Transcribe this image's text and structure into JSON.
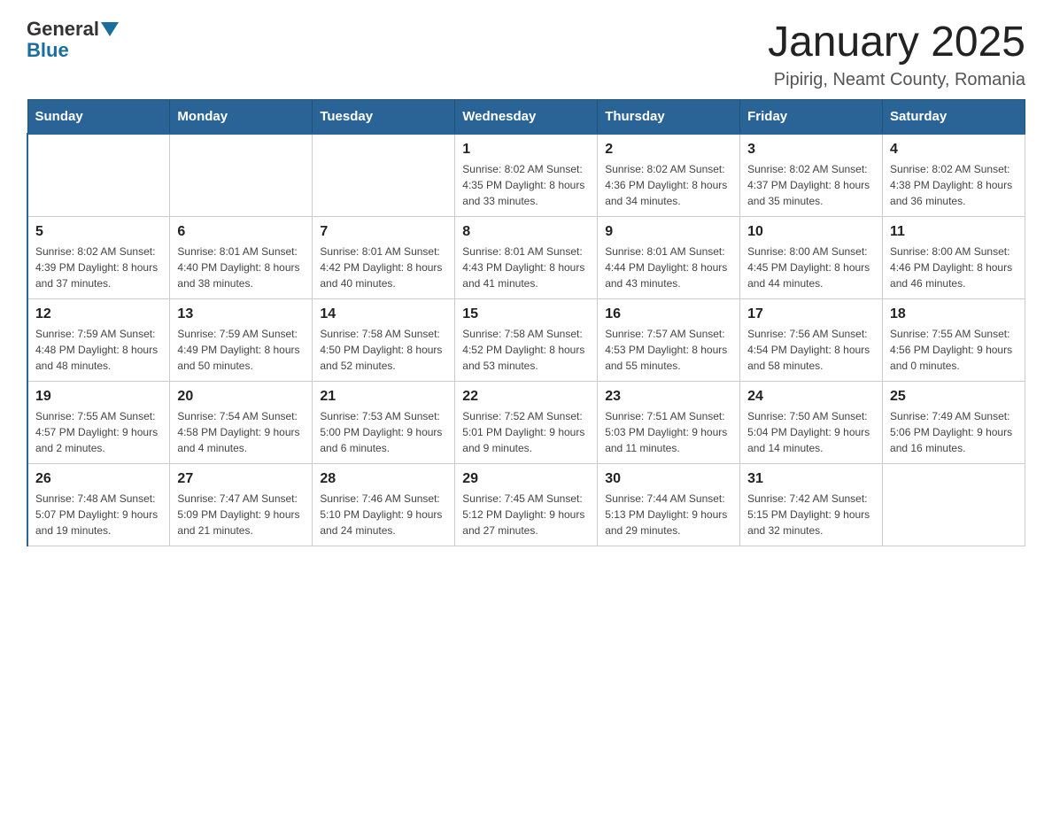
{
  "header": {
    "logo_general": "General",
    "logo_blue": "Blue",
    "month_title": "January 2025",
    "location": "Pipirig, Neamt County, Romania"
  },
  "days_of_week": [
    "Sunday",
    "Monday",
    "Tuesday",
    "Wednesday",
    "Thursday",
    "Friday",
    "Saturday"
  ],
  "weeks": [
    [
      {
        "day": "",
        "info": ""
      },
      {
        "day": "",
        "info": ""
      },
      {
        "day": "",
        "info": ""
      },
      {
        "day": "1",
        "info": "Sunrise: 8:02 AM\nSunset: 4:35 PM\nDaylight: 8 hours\nand 33 minutes."
      },
      {
        "day": "2",
        "info": "Sunrise: 8:02 AM\nSunset: 4:36 PM\nDaylight: 8 hours\nand 34 minutes."
      },
      {
        "day": "3",
        "info": "Sunrise: 8:02 AM\nSunset: 4:37 PM\nDaylight: 8 hours\nand 35 minutes."
      },
      {
        "day": "4",
        "info": "Sunrise: 8:02 AM\nSunset: 4:38 PM\nDaylight: 8 hours\nand 36 minutes."
      }
    ],
    [
      {
        "day": "5",
        "info": "Sunrise: 8:02 AM\nSunset: 4:39 PM\nDaylight: 8 hours\nand 37 minutes."
      },
      {
        "day": "6",
        "info": "Sunrise: 8:01 AM\nSunset: 4:40 PM\nDaylight: 8 hours\nand 38 minutes."
      },
      {
        "day": "7",
        "info": "Sunrise: 8:01 AM\nSunset: 4:42 PM\nDaylight: 8 hours\nand 40 minutes."
      },
      {
        "day": "8",
        "info": "Sunrise: 8:01 AM\nSunset: 4:43 PM\nDaylight: 8 hours\nand 41 minutes."
      },
      {
        "day": "9",
        "info": "Sunrise: 8:01 AM\nSunset: 4:44 PM\nDaylight: 8 hours\nand 43 minutes."
      },
      {
        "day": "10",
        "info": "Sunrise: 8:00 AM\nSunset: 4:45 PM\nDaylight: 8 hours\nand 44 minutes."
      },
      {
        "day": "11",
        "info": "Sunrise: 8:00 AM\nSunset: 4:46 PM\nDaylight: 8 hours\nand 46 minutes."
      }
    ],
    [
      {
        "day": "12",
        "info": "Sunrise: 7:59 AM\nSunset: 4:48 PM\nDaylight: 8 hours\nand 48 minutes."
      },
      {
        "day": "13",
        "info": "Sunrise: 7:59 AM\nSunset: 4:49 PM\nDaylight: 8 hours\nand 50 minutes."
      },
      {
        "day": "14",
        "info": "Sunrise: 7:58 AM\nSunset: 4:50 PM\nDaylight: 8 hours\nand 52 minutes."
      },
      {
        "day": "15",
        "info": "Sunrise: 7:58 AM\nSunset: 4:52 PM\nDaylight: 8 hours\nand 53 minutes."
      },
      {
        "day": "16",
        "info": "Sunrise: 7:57 AM\nSunset: 4:53 PM\nDaylight: 8 hours\nand 55 minutes."
      },
      {
        "day": "17",
        "info": "Sunrise: 7:56 AM\nSunset: 4:54 PM\nDaylight: 8 hours\nand 58 minutes."
      },
      {
        "day": "18",
        "info": "Sunrise: 7:55 AM\nSunset: 4:56 PM\nDaylight: 9 hours\nand 0 minutes."
      }
    ],
    [
      {
        "day": "19",
        "info": "Sunrise: 7:55 AM\nSunset: 4:57 PM\nDaylight: 9 hours\nand 2 minutes."
      },
      {
        "day": "20",
        "info": "Sunrise: 7:54 AM\nSunset: 4:58 PM\nDaylight: 9 hours\nand 4 minutes."
      },
      {
        "day": "21",
        "info": "Sunrise: 7:53 AM\nSunset: 5:00 PM\nDaylight: 9 hours\nand 6 minutes."
      },
      {
        "day": "22",
        "info": "Sunrise: 7:52 AM\nSunset: 5:01 PM\nDaylight: 9 hours\nand 9 minutes."
      },
      {
        "day": "23",
        "info": "Sunrise: 7:51 AM\nSunset: 5:03 PM\nDaylight: 9 hours\nand 11 minutes."
      },
      {
        "day": "24",
        "info": "Sunrise: 7:50 AM\nSunset: 5:04 PM\nDaylight: 9 hours\nand 14 minutes."
      },
      {
        "day": "25",
        "info": "Sunrise: 7:49 AM\nSunset: 5:06 PM\nDaylight: 9 hours\nand 16 minutes."
      }
    ],
    [
      {
        "day": "26",
        "info": "Sunrise: 7:48 AM\nSunset: 5:07 PM\nDaylight: 9 hours\nand 19 minutes."
      },
      {
        "day": "27",
        "info": "Sunrise: 7:47 AM\nSunset: 5:09 PM\nDaylight: 9 hours\nand 21 minutes."
      },
      {
        "day": "28",
        "info": "Sunrise: 7:46 AM\nSunset: 5:10 PM\nDaylight: 9 hours\nand 24 minutes."
      },
      {
        "day": "29",
        "info": "Sunrise: 7:45 AM\nSunset: 5:12 PM\nDaylight: 9 hours\nand 27 minutes."
      },
      {
        "day": "30",
        "info": "Sunrise: 7:44 AM\nSunset: 5:13 PM\nDaylight: 9 hours\nand 29 minutes."
      },
      {
        "day": "31",
        "info": "Sunrise: 7:42 AM\nSunset: 5:15 PM\nDaylight: 9 hours\nand 32 minutes."
      },
      {
        "day": "",
        "info": ""
      }
    ]
  ]
}
